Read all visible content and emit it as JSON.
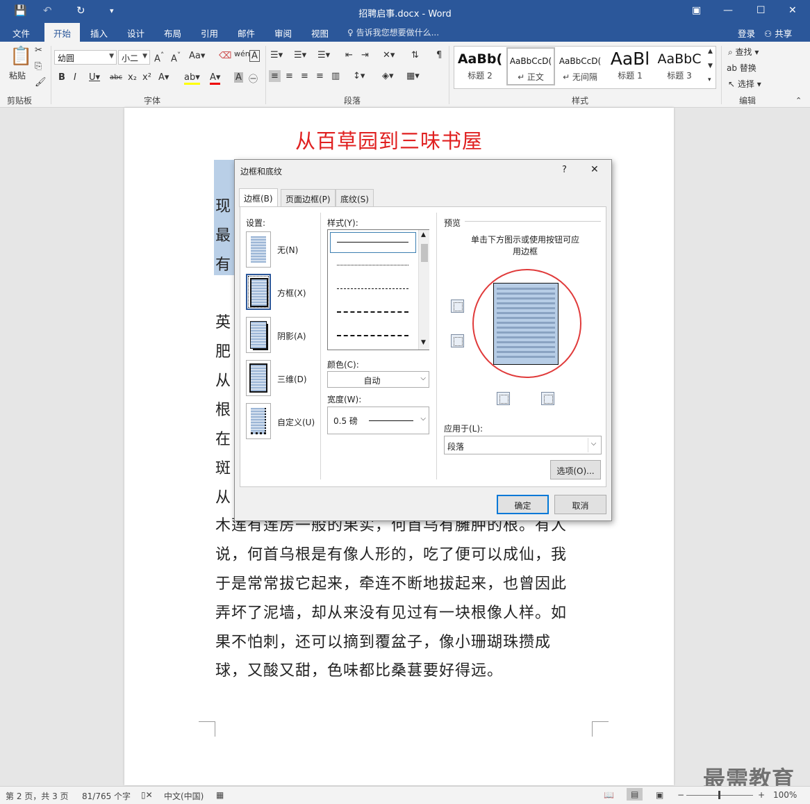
{
  "window": {
    "title": "招聘启事.docx - Word"
  },
  "tabs": [
    "文件",
    "开始",
    "插入",
    "设计",
    "布局",
    "引用",
    "邮件",
    "审阅",
    "视图"
  ],
  "tell_me": "告诉我您想要做什么...",
  "account": {
    "login": "登录",
    "share": "共享"
  },
  "ribbon": {
    "clipboard": {
      "paste": "粘贴",
      "label": "剪贴板"
    },
    "font": {
      "name": "幼圆",
      "size": "小二",
      "label": "字体"
    },
    "paragraph": {
      "label": "段落"
    },
    "styles": {
      "label": "样式",
      "items": [
        {
          "preview": "AaBb(",
          "name": "标题 2"
        },
        {
          "preview": "AaBbCcD(",
          "name": "↵ 正文"
        },
        {
          "preview": "AaBbCcD(",
          "name": "↵ 无间隔"
        },
        {
          "preview": "AaBl",
          "name": "标题 1"
        },
        {
          "preview": "AaBbC",
          "name": "标题 3"
        }
      ]
    },
    "editing": {
      "find": "查找",
      "replace": "替换",
      "select": "选择",
      "label": "编辑"
    }
  },
  "document": {
    "title": "从百草园到三味书屋",
    "lines_left": [
      "现",
      "最",
      "有",
      "英",
      "肥",
      "从",
      "根",
      "在",
      "斑",
      "从"
    ],
    "line_partial": "木莲有莲房一般的果实，何首乌有臃肿的根。有人",
    "lines": [
      "说，何首乌根是有像人形的，吃了便可以成仙，我",
      "于是常常拔它起来，牵连不断地拔起来，也曾因此",
      "弄坏了泥墙，却从来没有见过有一块根像人样。如",
      "果不怕刺，还可以摘到覆盆子，像小珊瑚珠攒成",
      "球，又酸又甜，色味都比桑葚要好得远。"
    ]
  },
  "dialog": {
    "title": "边框和底纹",
    "help": "?",
    "close": "✕",
    "tabs": [
      "边框(B)",
      "页面边框(P)",
      "底纹(S)"
    ],
    "settings_label": "设置:",
    "settings": [
      "无(N)",
      "方框(X)",
      "阴影(A)",
      "三维(D)",
      "自定义(U)"
    ],
    "style_label": "样式(Y):",
    "color_label": "颜色(C):",
    "color_value": "自动",
    "width_label": "宽度(W):",
    "width_value": "0.5 磅",
    "preview_label": "预览",
    "preview_hint": "单击下方图示或使用按钮可应用边框",
    "apply_label": "应用于(L):",
    "apply_value": "段落",
    "options": "选项(O)...",
    "ok": "确定",
    "cancel": "取消"
  },
  "status": {
    "page": "第 2 页，共 3 页",
    "words": "81/765 个字",
    "lang": "中文(中国)",
    "zoom": "100%"
  },
  "watermark": "最需教育"
}
